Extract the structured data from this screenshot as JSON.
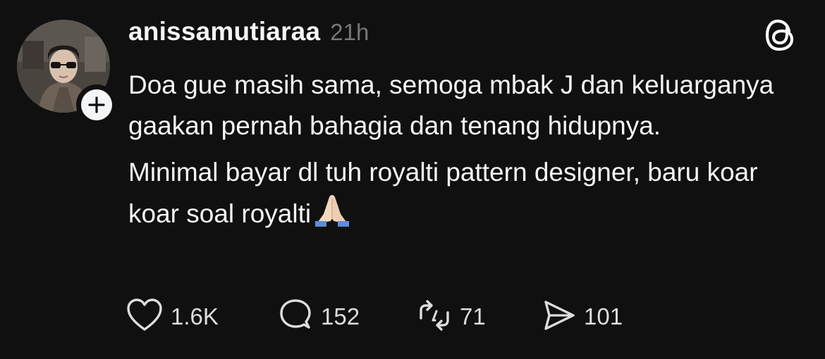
{
  "post": {
    "username": "anissamutiaraa",
    "time": "21h",
    "body": [
      "Doa gue masih sama, semoga mbak J dan keluarganya gaakan pernah bahagia dan tenang hidupnya.",
      "Minimal bayar dl tuh royalti pattern designer, baru koar koar soal royalti"
    ],
    "body_emoji": "folded-hands-emoji"
  },
  "actions": {
    "likes": "1.6K",
    "replies": "152",
    "reposts": "71",
    "shares": "101"
  },
  "icons": {
    "logo": "threads-logo-icon",
    "follow": "plus-icon",
    "like": "heart-icon",
    "reply": "comment-icon",
    "repost": "repost-icon",
    "share": "send-icon"
  },
  "colors": {
    "background": "#101010",
    "text": "#f3f5f7",
    "muted": "#777777"
  }
}
